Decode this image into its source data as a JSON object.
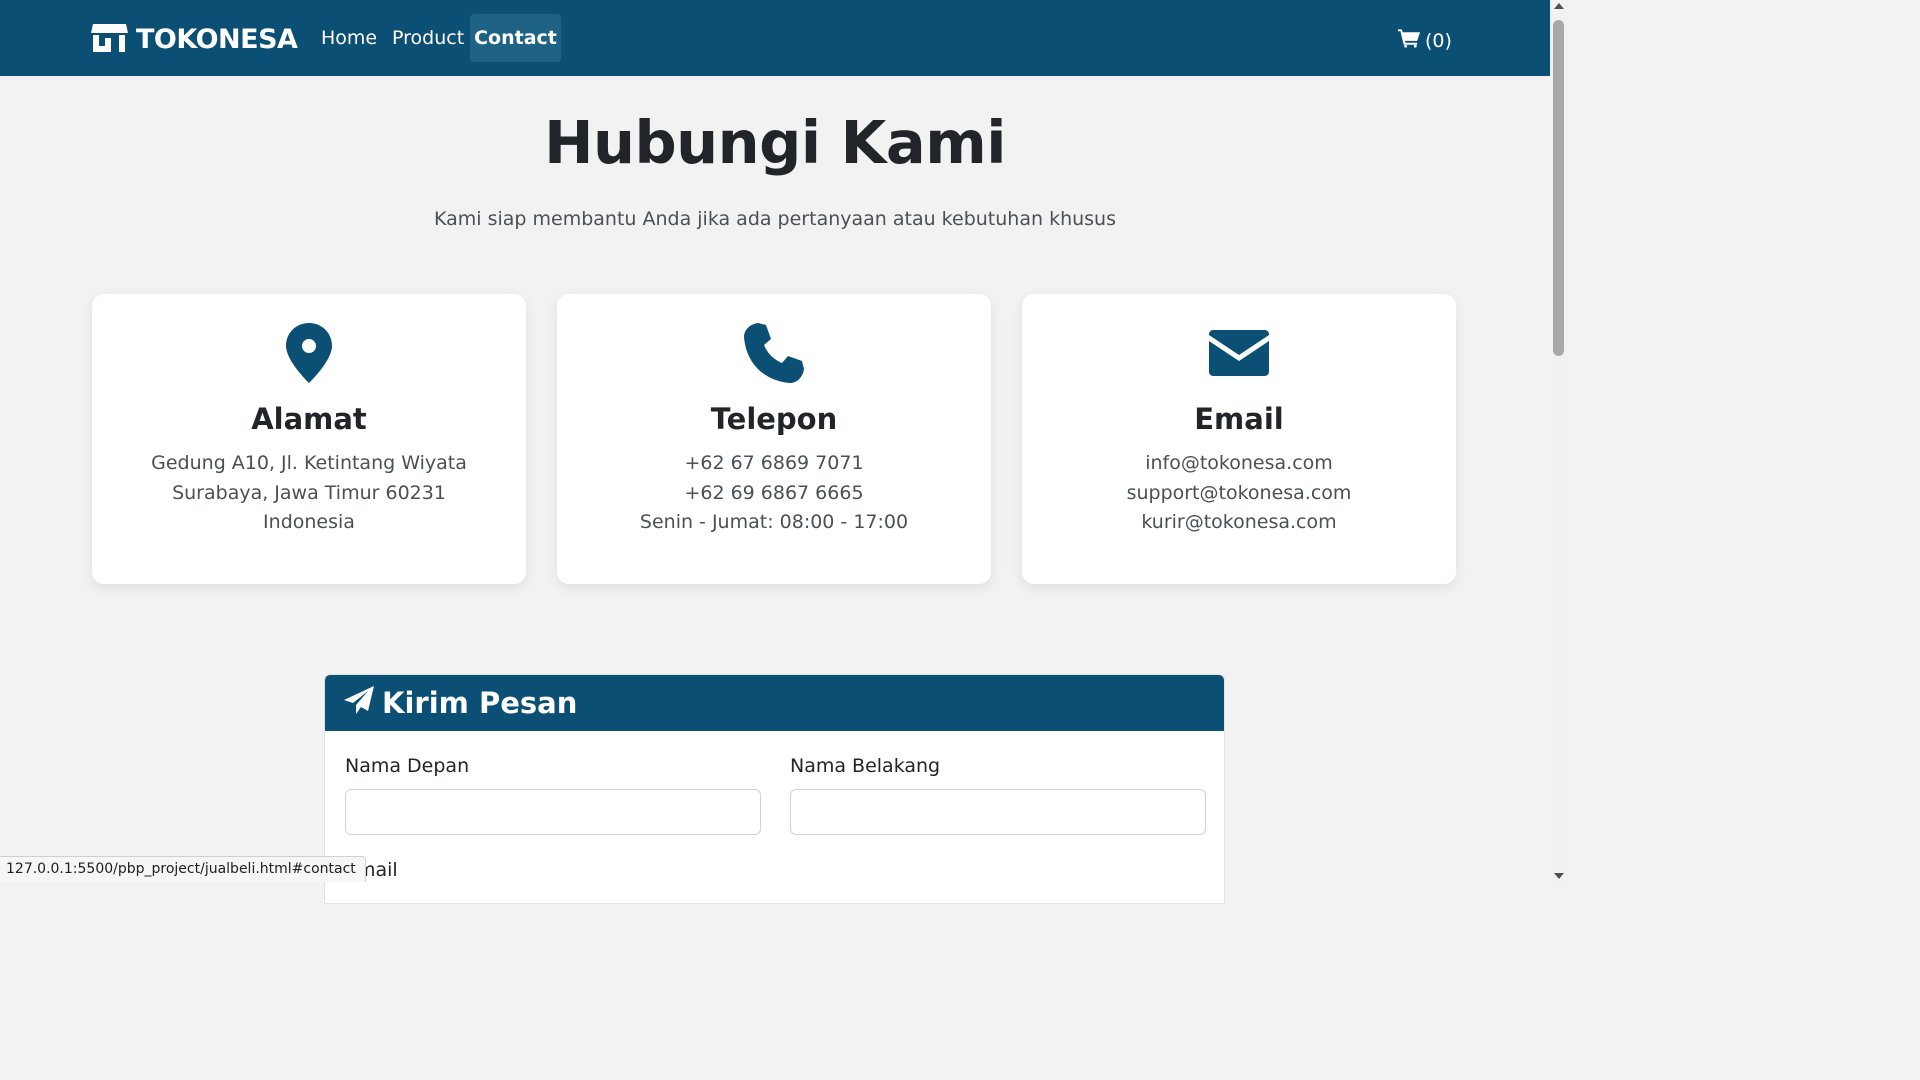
{
  "navbar": {
    "brand": "TOKONESA",
    "links": [
      "Home",
      "Product",
      "Contact"
    ],
    "active": "Contact",
    "cart_count": "(0)",
    "bg_color": "#0c4f74"
  },
  "hero": {
    "title": "Hubungi Kami",
    "subtitle": "Kami siap membantu Anda jika ada pertanyaan atau kebutuhan khusus"
  },
  "cards": [
    {
      "icon": "map-pin-icon",
      "title": "Alamat",
      "lines": [
        "Gedung A10, Jl. Ketintang Wiyata",
        "Surabaya, Jawa Timur 60231",
        "Indonesia"
      ]
    },
    {
      "icon": "phone-icon",
      "title": "Telepon",
      "lines": [
        "+62 67 6869 7071",
        "+62 69 6867 6665",
        "Senin - Jumat: 08:00 - 17:00"
      ]
    },
    {
      "icon": "envelope-icon",
      "title": "Email",
      "lines": [
        "info@tokonesa.com",
        "support@tokonesa.com",
        "kurir@tokonesa.com"
      ]
    }
  ],
  "form": {
    "header": "Kirim Pesan",
    "header_icon": "paper-plane-icon",
    "first_name_label": "Nama Depan",
    "first_name_value": "",
    "last_name_label": "Nama Belakang",
    "last_name_value": "",
    "email_label": "Email"
  },
  "status_bar": {
    "url": "127.0.0.1:5500/pbp_project/jualbeli.html#contact"
  }
}
